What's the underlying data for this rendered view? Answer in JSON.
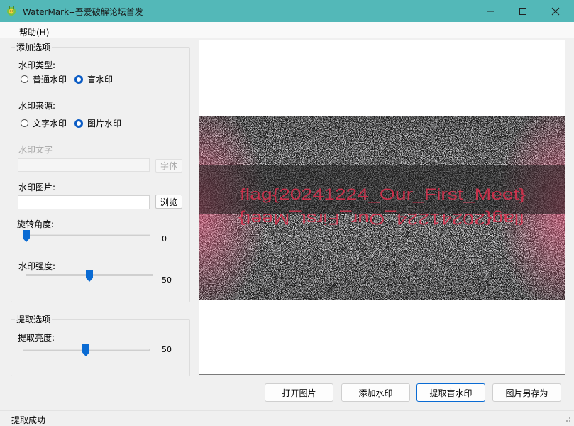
{
  "window": {
    "title": "WaterMark--吾爱破解论坛首发",
    "minimize": "—",
    "maximize": "☐",
    "close": "✕"
  },
  "menu": {
    "help": "帮助(H)"
  },
  "add_options": {
    "group_title": "添加选项",
    "type_label": "水印类型:",
    "type_options": [
      "普通水印",
      "盲水印"
    ],
    "type_selected": "盲水印",
    "source_label": "水印来源:",
    "source_options": [
      "文字水印",
      "图片水印"
    ],
    "source_selected": "图片水印",
    "text_label": "水印文字",
    "text_value": "",
    "font_button": "字体",
    "image_label": "水印图片:",
    "image_value": "",
    "browse_button": "浏览",
    "rotation_label": "旋转角度:",
    "rotation_value": "0",
    "strength_label": "水印强度:",
    "strength_value": "50"
  },
  "extract_options": {
    "group_title": "提取选项",
    "brightness_label": "提取亮度:",
    "brightness_value": "50"
  },
  "preview": {
    "line1": "flag{20241224_Our_First_Meet}",
    "line2": "flag{20241224_Our_First_Meet}"
  },
  "buttons": {
    "open": "打开图片",
    "add": "添加水印",
    "extract": "提取盲水印",
    "save_as": "图片另存为"
  },
  "status": {
    "text": "提取成功"
  },
  "colors": {
    "titlebar": "#53b8b8",
    "accent": "#0a6bd3",
    "watermark": "#e0304e"
  }
}
